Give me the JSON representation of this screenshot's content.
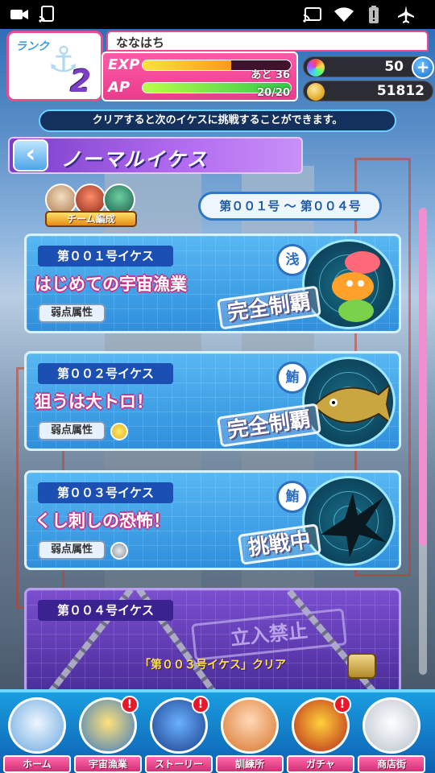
{
  "status_bar": {
    "icons": [
      "video-camera-icon",
      "cast-icon",
      "cast-icon",
      "wifi-icon",
      "battery-alert-icon",
      "airplane-mode-icon"
    ]
  },
  "player": {
    "rank_label": "ランク",
    "rank": "2",
    "name": "ななはち",
    "exp_label": "EXP",
    "exp_remaining": "あと 36",
    "exp_fill": 0.6,
    "ap_label": "AP",
    "ap_value": "20/20",
    "ap_fill": 1.0,
    "gems": "50",
    "coins": "51812"
  },
  "hint_text": "クリアすると次のイケスに挑戦することができます。",
  "title": "ノーマルイケス",
  "team_button_label": "チーム編成",
  "range_label": "第００１号 ～ 第００４号",
  "stages": [
    {
      "label": "第００１号イケス",
      "name": "はじめての宇宙漁業",
      "weak_label": "弱点属性",
      "kanji": "浅",
      "status": "完全制覇",
      "weak_icon": "none"
    },
    {
      "label": "第００２号イケス",
      "name": "狙うは大トロ！",
      "weak_label": "弱点属性",
      "kanji": "鮪",
      "status": "完全制覇",
      "weak_icon": "yellow-attribute-icon"
    },
    {
      "label": "第００３号イケス",
      "name": "くし刺しの恐怖！",
      "weak_label": "弱点属性",
      "kanji": "鮪",
      "status": "挑戦中",
      "weak_icon": "gray-attribute-icon"
    }
  ],
  "locked_stage": {
    "label": "第００４号イケス",
    "stamp": "立入禁止",
    "condition": "「第００３号イケス」クリア"
  },
  "nav": [
    {
      "label": "ホーム",
      "badge": ""
    },
    {
      "label": "宇宙漁業",
      "badge": "!"
    },
    {
      "label": "ストーリー",
      "badge": "!"
    },
    {
      "label": "訓練所",
      "badge": ""
    },
    {
      "label": "ガチャ",
      "badge": "!"
    },
    {
      "label": "商店街",
      "badge": ""
    }
  ],
  "colors": {
    "accent_pink": "#e84c8f",
    "card_blue": "#3a9ae4",
    "title_purple": "#7a3fc9",
    "nav_blue": "#1a9de0"
  }
}
